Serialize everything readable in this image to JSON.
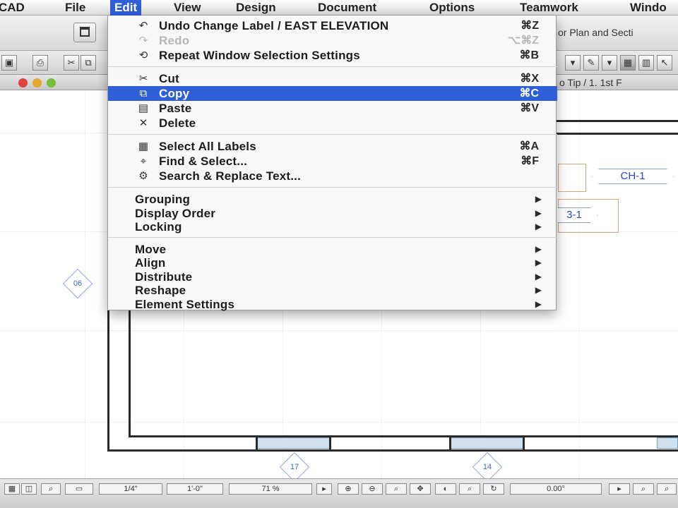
{
  "menubar": {
    "items": [
      "CAD",
      "File",
      "Edit",
      "View",
      "Design",
      "Document",
      "Options",
      "Teamwork",
      "Windo"
    ],
    "active": "Edit"
  },
  "toolbar": {
    "window_title_partial": "or Plan and Secti"
  },
  "window": {
    "title_partial": "o Tip / 1. 1st F"
  },
  "edit_menu": {
    "groups": [
      [
        {
          "label": "Undo Change Label / EAST ELEVATION",
          "shortcut": "⌘Z",
          "icon": "undo-icon",
          "glyph": "↶",
          "state": "normal"
        },
        {
          "label": "Redo",
          "shortcut": "⌥⌘Z",
          "icon": "redo-icon",
          "glyph": "↷",
          "state": "disabled"
        },
        {
          "label": "Repeat Window Selection Settings",
          "shortcut": "⌘B",
          "icon": "repeat-icon",
          "glyph": "⟲",
          "state": "normal"
        }
      ],
      [
        {
          "label": "Cut",
          "shortcut": "⌘X",
          "icon": "scissors-icon",
          "glyph": "✂",
          "state": "normal"
        },
        {
          "label": "Copy",
          "shortcut": "⌘C",
          "icon": "copy-icon",
          "glyph": "⧉",
          "state": "selected"
        },
        {
          "label": "Paste",
          "shortcut": "⌘V",
          "icon": "paste-icon",
          "glyph": "▤",
          "state": "normal"
        },
        {
          "label": "Delete",
          "shortcut": "",
          "icon": "delete-icon",
          "glyph": "✕",
          "state": "normal"
        }
      ],
      [
        {
          "label": "Select All Labels",
          "shortcut": "⌘A",
          "icon": "select-all-icon",
          "glyph": "▦",
          "state": "normal"
        },
        {
          "label": "Find & Select...",
          "shortcut": "⌘F",
          "icon": "find-select-icon",
          "glyph": "⌖",
          "state": "normal"
        },
        {
          "label": "Search & Replace Text...",
          "shortcut": "",
          "icon": "search-replace-icon",
          "glyph": "⚙",
          "state": "normal"
        }
      ],
      [
        {
          "label": "Grouping",
          "submenu": true
        },
        {
          "label": "Display Order",
          "submenu": true
        },
        {
          "label": "Locking",
          "submenu": true
        }
      ],
      [
        {
          "label": "Move",
          "submenu": true
        },
        {
          "label": "Align",
          "submenu": true
        },
        {
          "label": "Distribute",
          "submenu": true
        },
        {
          "label": "Reshape",
          "submenu": true
        },
        {
          "label": "Element Settings",
          "submenu": true
        }
      ]
    ]
  },
  "canvas": {
    "labels": {
      "ch1": "CH-1",
      "partial": "3-1"
    },
    "markers": {
      "m06": "06",
      "m17": "17",
      "m14": "14"
    }
  },
  "statusbar": {
    "scale_a": "1/4\"",
    "scale_b": "1'-0\"",
    "zoom": "71 %",
    "angle": "0.00°"
  },
  "colors": {
    "selection": "#2f5fd6",
    "label_text": "#2c43d6"
  }
}
